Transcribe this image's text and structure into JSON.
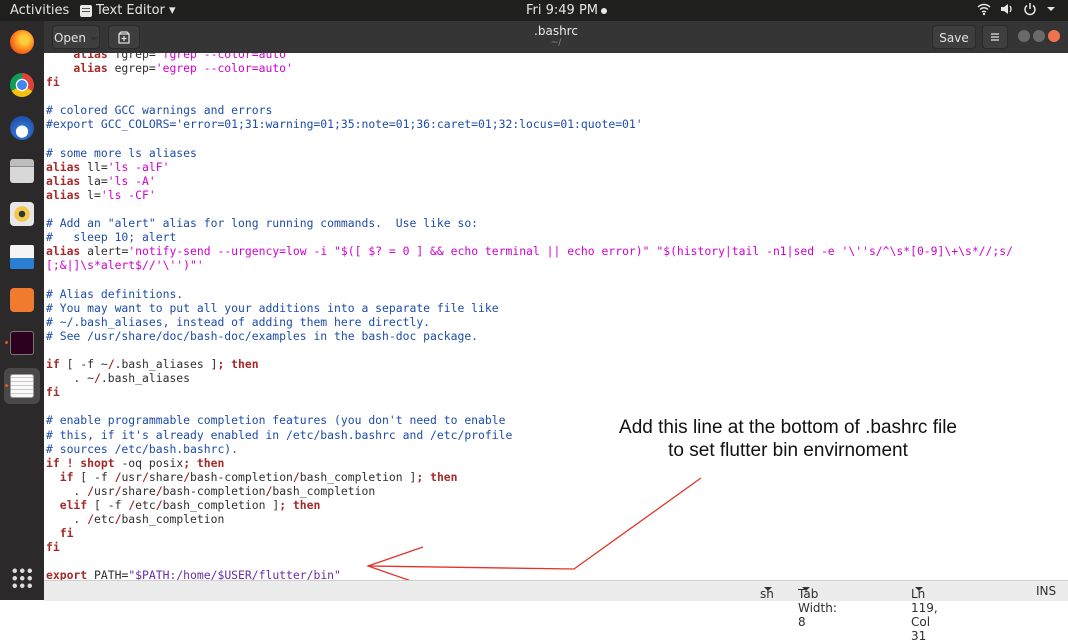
{
  "topbar": {
    "activities": "Activities",
    "app_name": "Text Editor ▾",
    "clock": "Fri  9:49 PM",
    "tray_icons": [
      "network-icon",
      "volume-icon",
      "power-icon"
    ]
  },
  "dock": {
    "apps": [
      "firefox-icon",
      "chrome-icon",
      "thunderbird-icon",
      "files-icon",
      "rhythmbox-icon",
      "libreoffice-writer-icon",
      "software-center-icon",
      "terminal-icon",
      "text-editor-icon"
    ],
    "active": "text-editor-icon"
  },
  "header": {
    "open_label": "Open",
    "title": ".bashrc",
    "subtitle": "~/",
    "save_label": "Save"
  },
  "code_lines": [
    [
      [
        "    alias ",
        "kw"
      ],
      [
        "fgrep=",
        "pl"
      ],
      [
        "'fgrep --color=auto'",
        "st"
      ]
    ],
    [
      [
        "    alias ",
        "kw"
      ],
      [
        "egrep=",
        "pl"
      ],
      [
        "'egrep --color=auto'",
        "st"
      ]
    ],
    [
      [
        "fi",
        "kw"
      ]
    ],
    [
      [
        "",
        ""
      ]
    ],
    [
      [
        "# colored GCC warnings and errors",
        "cm"
      ]
    ],
    [
      [
        "#export GCC_COLORS='error=01;31:warning=01;35:note=01;36:caret=01;32:locus=01:quote=01'",
        "cm"
      ]
    ],
    [
      [
        "",
        ""
      ]
    ],
    [
      [
        "# some more ls aliases",
        "cm"
      ]
    ],
    [
      [
        "alias ",
        "kw"
      ],
      [
        "ll=",
        "pl"
      ],
      [
        "'ls -alF'",
        "st"
      ]
    ],
    [
      [
        "alias ",
        "kw"
      ],
      [
        "la=",
        "pl"
      ],
      [
        "'ls -A'",
        "st"
      ]
    ],
    [
      [
        "alias ",
        "kw"
      ],
      [
        "l=",
        "pl"
      ],
      [
        "'ls -CF'",
        "st"
      ]
    ],
    [
      [
        "",
        ""
      ]
    ],
    [
      [
        "# Add an \"alert\" alias for long running commands.  Use like so:",
        "cm"
      ]
    ],
    [
      [
        "#   sleep 10; alert",
        "cm"
      ]
    ],
    [
      [
        "alias ",
        "kw"
      ],
      [
        "alert=",
        "pl"
      ],
      [
        "'notify-send --urgency=low -i \"$([ $? = 0 ] && echo terminal || echo error)\" \"$(history|tail -n1|sed -e '\\''s/^\\s*[0-9]\\+\\s*//;s/",
        "st"
      ]
    ],
    [
      [
        "[;&|]\\s*alert$//'\\'')\"'",
        "st"
      ]
    ],
    [
      [
        "",
        ""
      ]
    ],
    [
      [
        "# Alias definitions.",
        "cm"
      ]
    ],
    [
      [
        "# You may want to put all your additions into a separate file like",
        "cm"
      ]
    ],
    [
      [
        "# ~/.bash_aliases, instead of adding them here directly.",
        "cm"
      ]
    ],
    [
      [
        "# See /usr/share/doc/bash-doc/examples in the bash-doc package.",
        "cm"
      ]
    ],
    [
      [
        "",
        ""
      ]
    ],
    [
      [
        "if ",
        "kw"
      ],
      [
        "[ -f ~",
        "pl"
      ],
      [
        "/",
        "kw"
      ],
      [
        ".bash_aliases ]",
        "pl"
      ],
      [
        "; then",
        "kw"
      ]
    ],
    [
      [
        "    . ~",
        "pl"
      ],
      [
        "/",
        "kw"
      ],
      [
        ".bash_aliases",
        "pl"
      ]
    ],
    [
      [
        "fi",
        "kw"
      ]
    ],
    [
      [
        "",
        ""
      ]
    ],
    [
      [
        "# enable programmable completion features (you don't need to enable",
        "cm"
      ]
    ],
    [
      [
        "# this, if it's already enabled in /etc/bash.bashrc and /etc/profile",
        "cm"
      ]
    ],
    [
      [
        "# sources /etc/bash.bashrc).",
        "cm"
      ]
    ],
    [
      [
        "if ! ",
        "kw"
      ],
      [
        "shopt ",
        "kw"
      ],
      [
        "-oq posix",
        "pl"
      ],
      [
        "; then",
        "kw"
      ]
    ],
    [
      [
        "  if ",
        "kw"
      ],
      [
        "[ -f ",
        "pl"
      ],
      [
        "/",
        "kw"
      ],
      [
        "usr",
        "pl"
      ],
      [
        "/",
        "kw"
      ],
      [
        "share",
        "pl"
      ],
      [
        "/",
        "kw"
      ],
      [
        "bash-completion",
        "pl"
      ],
      [
        "/",
        "kw"
      ],
      [
        "bash_completion ]",
        "pl"
      ],
      [
        "; then",
        "kw"
      ]
    ],
    [
      [
        "    . ",
        "pl"
      ],
      [
        "/",
        "kw"
      ],
      [
        "usr",
        "pl"
      ],
      [
        "/",
        "kw"
      ],
      [
        "share",
        "pl"
      ],
      [
        "/",
        "kw"
      ],
      [
        "bash-completion",
        "pl"
      ],
      [
        "/",
        "kw"
      ],
      [
        "bash_completion",
        "pl"
      ]
    ],
    [
      [
        "  elif ",
        "kw"
      ],
      [
        "[ -f ",
        "pl"
      ],
      [
        "/",
        "kw"
      ],
      [
        "etc",
        "pl"
      ],
      [
        "/",
        "kw"
      ],
      [
        "bash_completion ]",
        "pl"
      ],
      [
        "; then",
        "kw"
      ]
    ],
    [
      [
        "    . ",
        "pl"
      ],
      [
        "/",
        "kw"
      ],
      [
        "etc",
        "pl"
      ],
      [
        "/",
        "kw"
      ],
      [
        "bash_completion",
        "pl"
      ]
    ],
    [
      [
        "  fi",
        "kw"
      ]
    ],
    [
      [
        "fi",
        "kw"
      ]
    ],
    [
      [
        "",
        ""
      ]
    ],
    [
      [
        "export ",
        "kw"
      ],
      [
        "PATH=",
        "pl"
      ],
      [
        "\"$PATH:/home/$USER/flutter/bin\"",
        "pa"
      ]
    ]
  ],
  "annotation": {
    "line1": "Add this line at the bottom of .bashrc file",
    "line2": "to set flutter bin envirnoment",
    "arrow_color": "#e0352b"
  },
  "statusbar": {
    "language": "sh",
    "tab_width": "Tab Width: 8",
    "position": "Ln 119, Col 31",
    "mode": "INS"
  }
}
